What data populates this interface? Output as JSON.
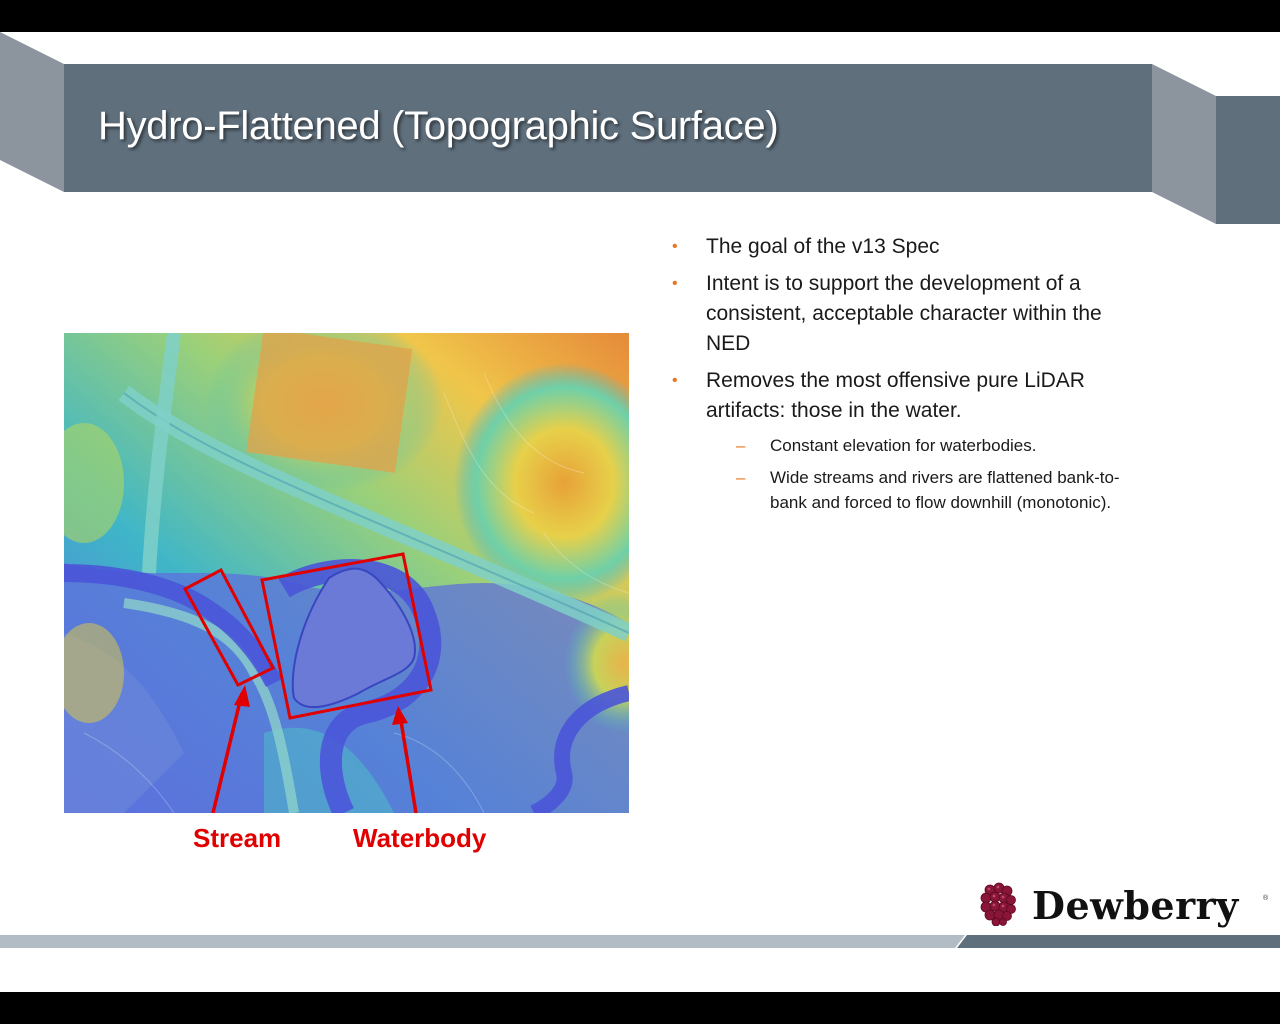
{
  "slide": {
    "title": "Hydro-Flattened (Topographic Surface)"
  },
  "figure": {
    "labels": {
      "stream": "Stream",
      "waterbody": "Waterbody"
    },
    "highlight_color": "#e00000"
  },
  "bullets": [
    {
      "text": "The goal of the v13 Spec"
    },
    {
      "text": "Intent is to support the development of a consistent, acceptable character within the NED"
    },
    {
      "text": "Removes the most offensive pure LiDAR artifacts:  those in the water.",
      "sub": [
        "Constant elevation for waterbodies.",
        "Wide streams and rivers are flattened bank-to-bank and forced to flow downhill (monotonic)."
      ]
    }
  ],
  "logo": {
    "name": "Dewberry",
    "mark_color": "#8a1538",
    "icon": "raspberry-icon"
  },
  "colors": {
    "title_band": "#5f6f7c",
    "accent": "#e87722",
    "footer_bar": "#b1bcc5"
  }
}
